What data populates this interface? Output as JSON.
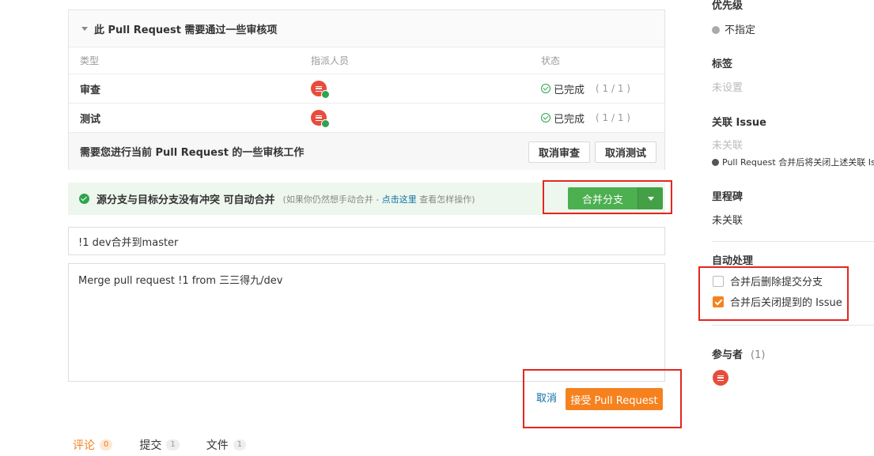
{
  "review": {
    "heading": "此 Pull Request 需要通过一些审核项",
    "columns": {
      "type": "类型",
      "assignee": "指派人员",
      "status": "状态"
    },
    "rows": [
      {
        "type": "审查",
        "status": "已完成",
        "count": "( 1 / 1 )"
      },
      {
        "type": "测试",
        "status": "已完成",
        "count": "( 1 / 1 )"
      }
    ],
    "footer_text": "需要您进行当前 Pull Request 的一些审核工作",
    "cancel_review": "取消审查",
    "cancel_test": "取消测试"
  },
  "merge": {
    "status_text": "源分支与目标分支没有冲突 可自动合并",
    "hint_prefix": "(如果你仍然想手动合并 - ",
    "hint_link": "点击这里",
    "hint_suffix": " 查看怎样操作)",
    "button_label": "合并分支"
  },
  "form": {
    "title_value": "!1 dev合并到master",
    "message_value": "Merge pull request !1 from 三三得九/dev",
    "cancel_label": "取消",
    "accept_label": "接受 Pull Request"
  },
  "tabs": [
    {
      "label": "评论",
      "count": "0"
    },
    {
      "label": "提交",
      "count": "1"
    },
    {
      "label": "文件",
      "count": "1"
    }
  ],
  "sidebar": {
    "priority_title": "优先级",
    "priority_value": "不指定",
    "labels_title": "标签",
    "labels_value": "未设置",
    "issue_title": "关联 Issue",
    "issue_value": "未关联",
    "issue_note": "Pull Request 合并后将关闭上述关联 Iss",
    "milestone_title": "里程碑",
    "milestone_value": "未关联",
    "auto_title": "自动处理",
    "auto_delete_branch": "合并后删除提交分支",
    "auto_close_issue": "合并后关闭提到的 Issue",
    "participants_title": "参与者",
    "participants_count": "(1)"
  },
  "colors": {
    "accent_orange": "#f5821f",
    "merge_green": "#4caf50",
    "highlight_red": "#e5261f",
    "link_blue": "#0b6fa4"
  },
  "auto_options_state": {
    "delete_branch": false,
    "close_issue": true
  }
}
